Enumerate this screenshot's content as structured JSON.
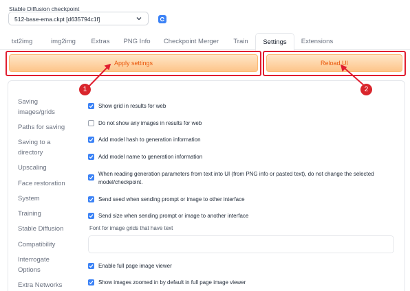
{
  "checkpoint": {
    "label": "Stable Diffusion checkpoint",
    "value": "512-base-ema.ckpt [d635794c1f]",
    "icon": "chevron-down-icon",
    "refresh_icon": "refresh-icon"
  },
  "tabs": [
    {
      "label": "txt2img",
      "active": false
    },
    {
      "label": "img2img",
      "active": false
    },
    {
      "label": "Extras",
      "active": false
    },
    {
      "label": "PNG Info",
      "active": false
    },
    {
      "label": "Checkpoint Merger",
      "active": false
    },
    {
      "label": "Train",
      "active": false
    },
    {
      "label": "Settings",
      "active": true
    },
    {
      "label": "Extensions",
      "active": false
    }
  ],
  "buttons": {
    "apply": "Apply settings",
    "reload": "Reload UI"
  },
  "sidebar": [
    {
      "label": "Saving images/grids"
    },
    {
      "label": "Paths for saving"
    },
    {
      "label": "Saving to a directory"
    },
    {
      "label": "Upscaling"
    },
    {
      "label": "Face restoration"
    },
    {
      "label": "System"
    },
    {
      "label": "Training"
    },
    {
      "label": "Stable Diffusion"
    },
    {
      "label": "Compatibility"
    },
    {
      "label": "Interrogate Options"
    },
    {
      "label": "Extra Networks"
    }
  ],
  "options": [
    {
      "label": "Show grid in results for web",
      "checked": true
    },
    {
      "label": "Do not show any images in results for web",
      "checked": false
    },
    {
      "label": "Add model hash to generation information",
      "checked": true
    },
    {
      "label": "Add model name to generation information",
      "checked": true
    },
    {
      "label": "When reading generation parameters from text into UI (from PNG info or pasted text), do not change the selected model/checkpoint.",
      "checked": true
    },
    {
      "label": "Send seed when sending prompt or image to other interface",
      "checked": true
    },
    {
      "label": "Send size when sending prompt or image to another interface",
      "checked": true
    },
    {
      "label": "Enable full page image viewer",
      "checked": true
    },
    {
      "label": "Show images zoomed in by default in full page image viewer",
      "checked": true
    }
  ],
  "font_field": {
    "label": "Font for image grids that have text",
    "value": ""
  },
  "annotations": [
    {
      "number": "1"
    },
    {
      "number": "2"
    }
  ],
  "colors": {
    "accent": "#3b82f6",
    "button_text": "#ea580c",
    "highlight": "#e11d2f",
    "marker": "#d9252c"
  }
}
